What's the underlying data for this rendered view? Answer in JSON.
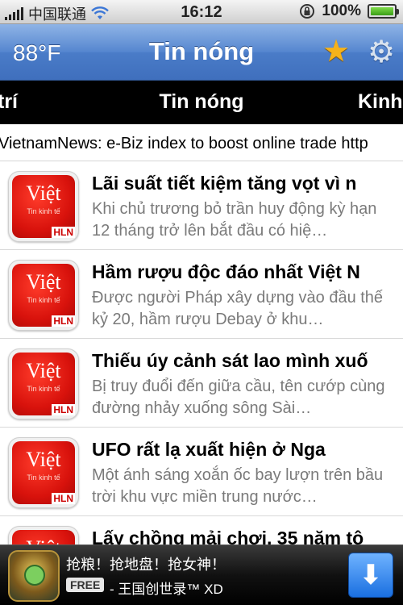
{
  "status": {
    "carrier": "中国联通",
    "time": "16:12",
    "battery": "100%",
    "battery_level": 1.0,
    "icons": [
      "signal-icon",
      "wifi-icon",
      "orientation-lock-icon",
      "battery-icon"
    ]
  },
  "navbar": {
    "temperature": "88°F",
    "title": "Tin nóng",
    "star_icon": "star-icon",
    "gear_icon": "gear-icon",
    "accent": "#4a7cc8"
  },
  "categories": {
    "left": "trí",
    "center": "Tin nóng",
    "right": "Kinh"
  },
  "ticker": {
    "text": "VietnamNews: e-Biz index to boost online trade http"
  },
  "thumb": {
    "word": "Việt",
    "sub": "Tin kinh tế",
    "badge": "HLN"
  },
  "articles": [
    {
      "title": "Lãi suất tiết kiệm tăng vọt vì n",
      "desc": "Khi chủ trương bỏ trần huy động kỳ hạn 12 tháng trở lên bắt đầu có hiệ…"
    },
    {
      "title": "Hầm rượu độc đáo nhất Việt N",
      "desc": "Được người Pháp xây dựng vào đầu thế kỷ 20, hầm rượu Debay ở khu…"
    },
    {
      "title": "Thiếu úy cảnh sát lao mình xuố",
      "desc": "Bị truy đuổi đến giữa cầu, tên cướp cùng đường nhảy xuống sông Sài…"
    },
    {
      "title": "UFO rất lạ xuất hiện ở Nga",
      "desc": "Một ánh sáng xoắn ốc bay lượn trên bầu trời khu vực miền trung nước…"
    },
    {
      "title": "Lấy chồng mải chơi, 35 năm tô",
      "desc": ""
    }
  ],
  "ad": {
    "line1": "抢粮！抢地盘！抢女神！",
    "free": "FREE",
    "line2": "- 王国创世录™ XD",
    "download_icon": "download-arrow-icon"
  }
}
